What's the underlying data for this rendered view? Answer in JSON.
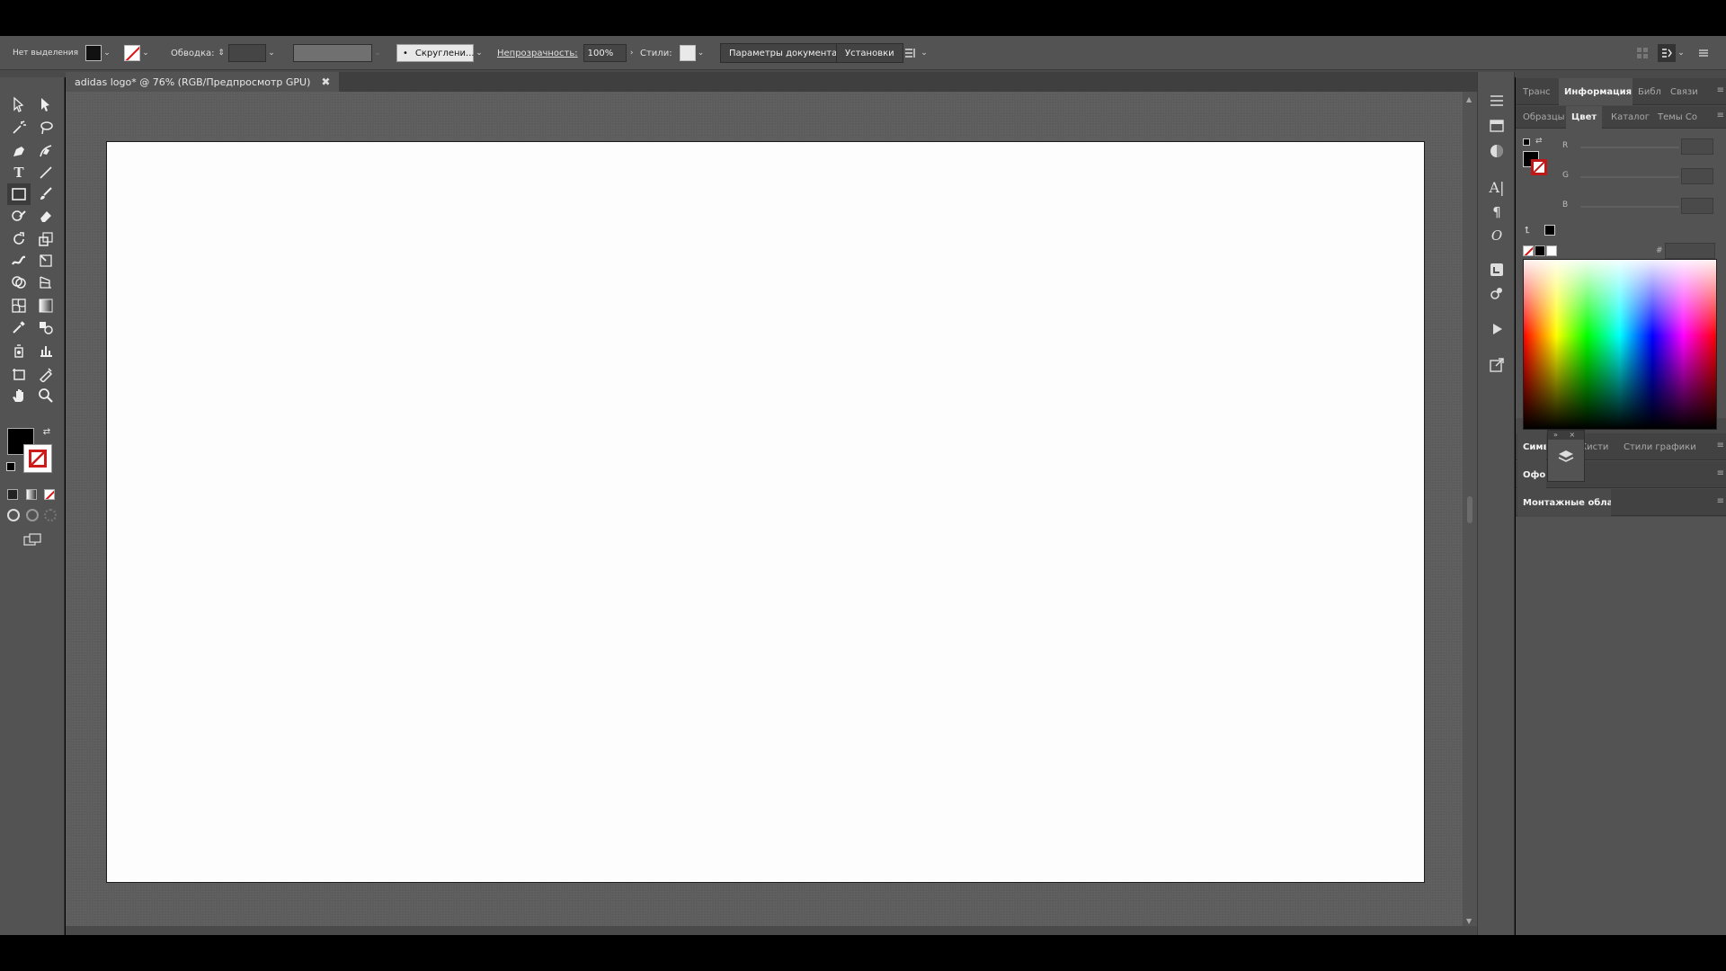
{
  "control_bar": {
    "selection_label": "Нет выделения",
    "stroke_label": "Обводка:",
    "profile_label": "Скруглени...",
    "opacity_label": "Непрозрачность:",
    "opacity_value": "100%",
    "styles_label": "Стили:",
    "doc_params_button": "Параметры документа",
    "settings_button": "Установки",
    "fill_color": "#000000"
  },
  "document": {
    "tab_title": "adidas logo* @ 76% (RGB/Предпросмотр GPU)",
    "close_glyph": "✖"
  },
  "panels": {
    "row1": {
      "tab1": "Транс",
      "tab2": "Информация",
      "tab3": "Библ",
      "tab4": "Связи"
    },
    "row2": {
      "tab1": "Образцы",
      "tab2": "Цвет",
      "tab3": "Каталог",
      "tab4": "Темы Со"
    },
    "color": {
      "r": "R",
      "g": "G",
      "b": "B",
      "hex": "#"
    },
    "row3": {
      "tab1": "Симв",
      "tab2": "Кисти",
      "tab3": "Стили графики"
    },
    "row4": {
      "tab1": "Офор"
    },
    "row5": {
      "tab1": "Монтажные области"
    }
  },
  "icons": {
    "tools": [
      "selection-icon",
      "direct-selection-icon",
      "magic-wand-icon",
      "lasso-icon",
      "pen-icon",
      "curvature-icon",
      "type-icon",
      "line-icon",
      "rectangle-icon",
      "paintbrush-icon",
      "shaper-icon",
      "eraser-icon",
      "rotate-icon",
      "scale-icon",
      "warp-icon",
      "free-transform-icon",
      "shape-builder-icon",
      "perspective-icon",
      "mesh-icon",
      "gradient-icon",
      "eyedropper-icon",
      "blend-icon",
      "symbol-sprayer-icon",
      "graph-icon",
      "artboard-icon",
      "slice-icon",
      "hand-icon",
      "zoom-icon"
    ],
    "dock": [
      "properties-icon",
      "layers-icon",
      "color-icon",
      "character-icon",
      "paragraph-icon",
      "opentype-icon",
      "libraries-icon",
      "appearance-icon",
      "actions-icon",
      "export-icon"
    ]
  }
}
